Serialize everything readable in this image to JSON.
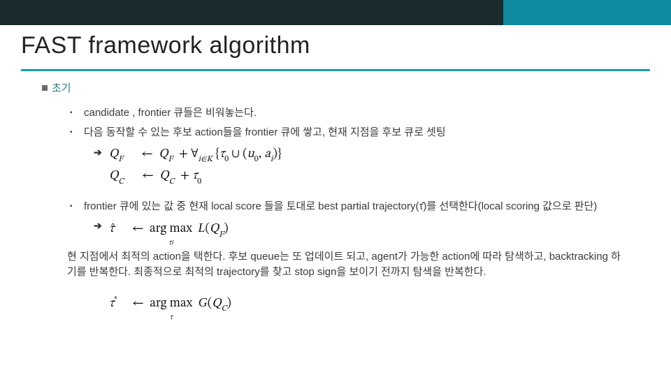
{
  "title": "FAST framework algorithm",
  "bullets": {
    "b0": "초기",
    "b1": "candidate , frontier 큐들은 비워놓는다.",
    "b2": "다음 동작할 수 있는 후보 action들을 frontier 큐에 쌓고, 현재 지점을 후보 큐로 셋팅",
    "b3": "frontier 큐에 있는 값 중 현재 local score 들을 토대로 best partial trajectory(τ̂)를 선택한다(local scoring 값으로 판단)"
  },
  "formulas": {
    "qf": "Q_F ← Q_F + ∀_{i∈K} { τ_0 ∪ (u_0, a_i) }",
    "qc": "Q_C ← Q_C + τ_0",
    "tauhat": "τ̂ ← arg max_{τ_i} L(Q_F)",
    "taustar": "τ* ← arg max_{τ} G(Q_C)"
  },
  "paragraph": "현 지점에서 최적의 action을 택한다. 후보 queue는 또 업데이트 되고, agent가 가능한 action에 따라 탐색하고, backtracking 하기를 반복한다. 최종적으로 최적의 trajectory를 찾고 stop sign을 보이기 전까지 탐색을 반복한다.",
  "colors": {
    "accent_dark": "#1a2b2e",
    "accent_teal": "#108a9f",
    "underline": "#1b9aaa",
    "init_label": "#2a7a88"
  }
}
